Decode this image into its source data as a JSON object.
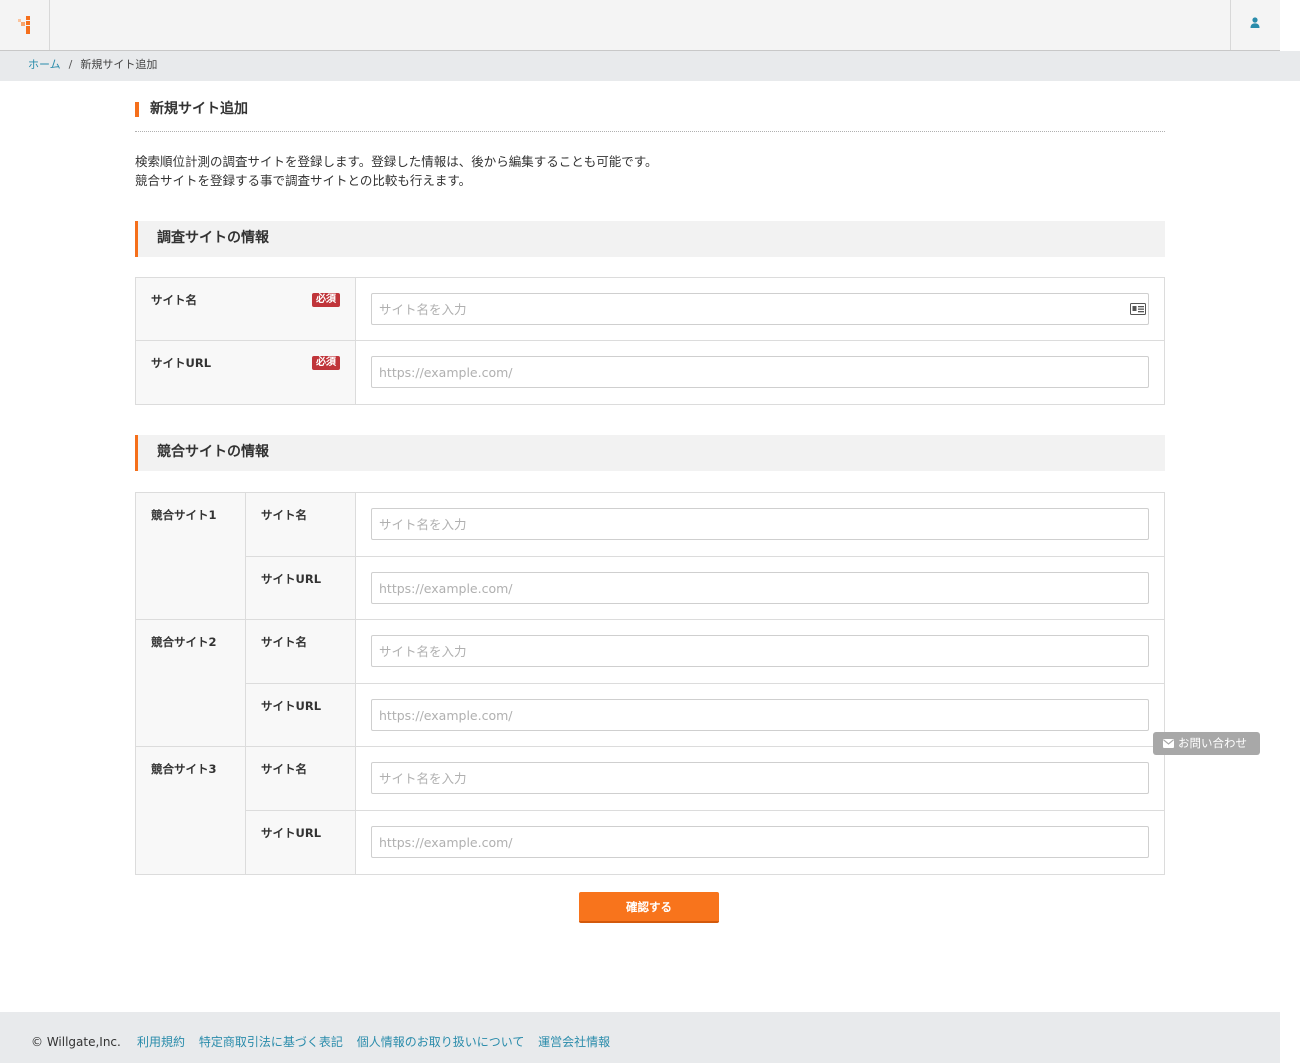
{
  "header": {
    "logo_icon": "logo-icon",
    "user_icon": "user-icon",
    "accent_color": "#f56f1b",
    "user_icon_color": "#2a8cab"
  },
  "breadcrumb": {
    "home": "ホーム",
    "separator": "/",
    "current": "新規サイト追加"
  },
  "page": {
    "title": "新規サイト追加",
    "intro_line1": "検索順位計測の調査サイトを登録します。登録した情報は、後から編集することも可能です。",
    "intro_line2": "競合サイトを登録する事で調査サイトとの比較も行えます。"
  },
  "own_site": {
    "heading": "調査サイトの情報",
    "name_label": "サイト名",
    "name_placeholder": "サイト名を入力",
    "url_label": "サイトURL",
    "url_placeholder": "https://example.com/",
    "required_label": "必須"
  },
  "competitors": {
    "heading": "競合サイトの情報",
    "items": [
      {
        "label": "競合サイト1",
        "name_label": "サイト名",
        "name_placeholder": "サイト名を入力",
        "url_label": "サイトURL",
        "url_placeholder": "https://example.com/"
      },
      {
        "label": "競合サイト2",
        "name_label": "サイト名",
        "name_placeholder": "サイト名を入力",
        "url_label": "サイトURL",
        "url_placeholder": "https://example.com/"
      },
      {
        "label": "競合サイト3",
        "name_label": "サイト名",
        "name_placeholder": "サイト名を入力",
        "url_label": "サイトURL",
        "url_placeholder": "https://example.com/"
      }
    ]
  },
  "actions": {
    "confirm_label": "確認する",
    "confirm_color": "#f8741c"
  },
  "contact": {
    "label": "お問い合わせ",
    "icon": "mail-icon"
  },
  "footer": {
    "copyright": "© Willgate,Inc.",
    "links": [
      "利用規約",
      "特定商取引法に基づく表記",
      "個人情報のお取り扱いについて",
      "運営会社情報"
    ]
  }
}
